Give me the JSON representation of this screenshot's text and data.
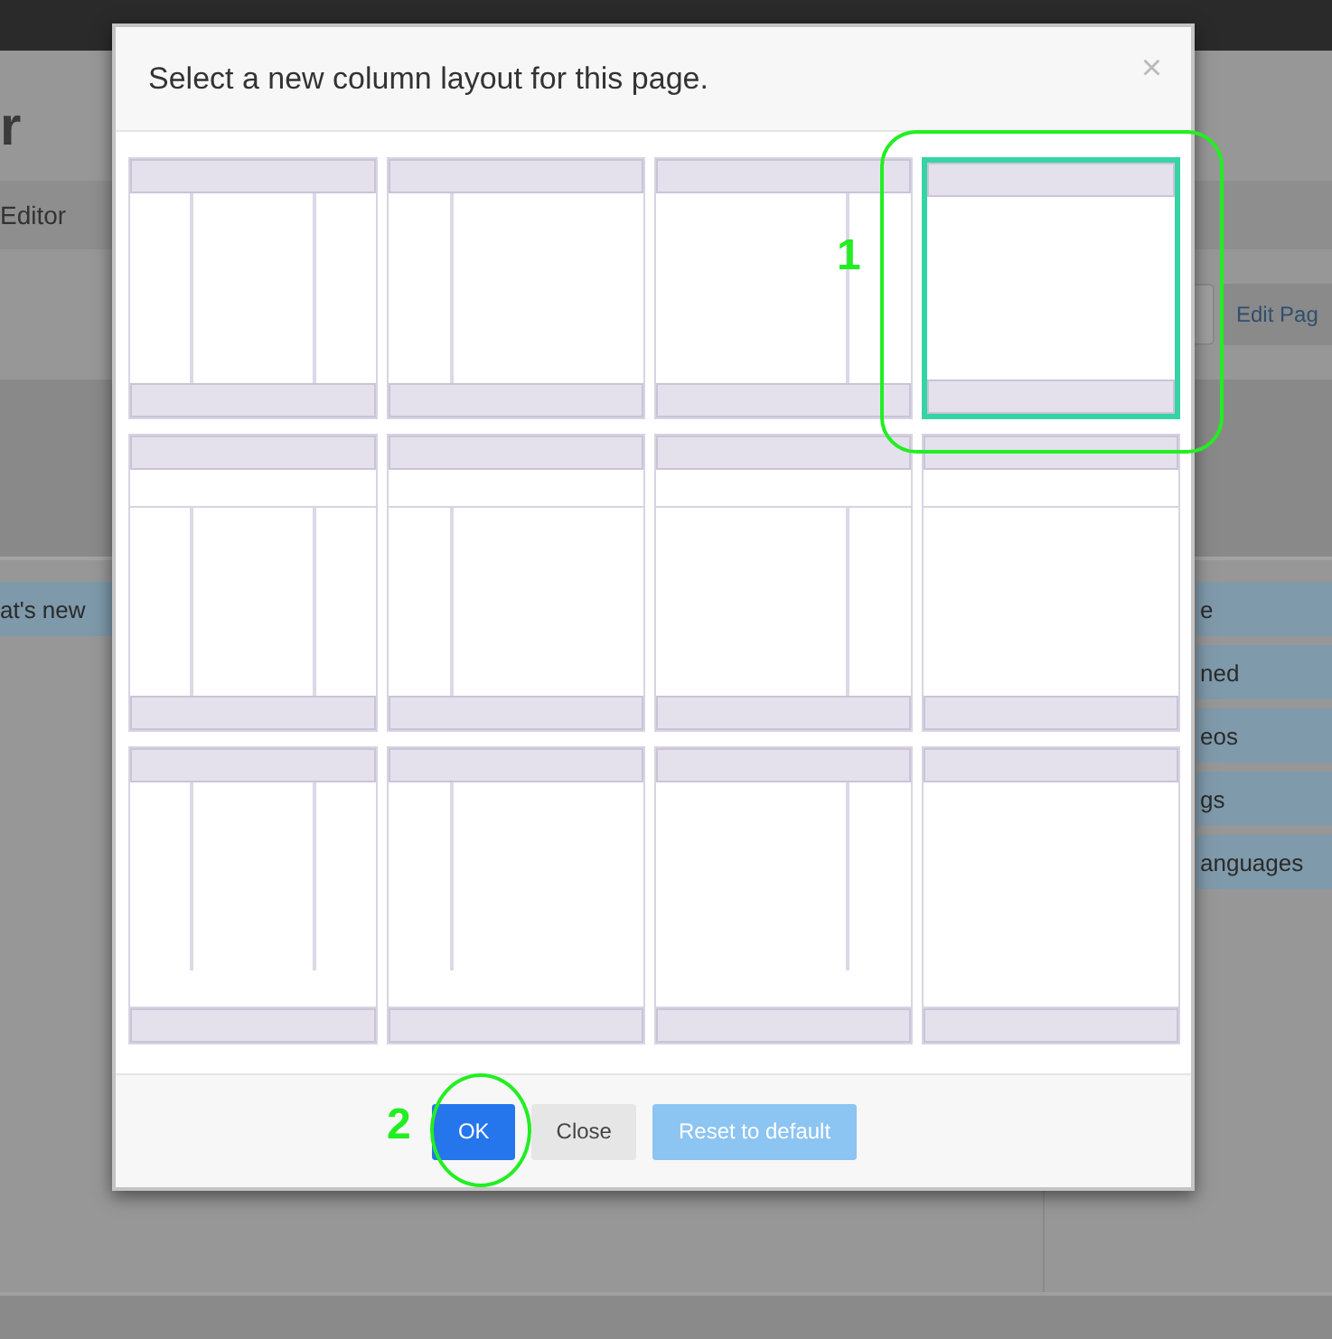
{
  "background_page": {
    "heading": "r",
    "tab": "Editor",
    "edit_link": "Edit Pag",
    "left_item": "at's new",
    "right_items": [
      "e",
      "ned",
      "eos",
      "gs",
      "anguages"
    ]
  },
  "dialog": {
    "title": "Select a new column layout for this page.",
    "close": "×",
    "layouts": [
      {
        "kind": "three",
        "top_band": false,
        "bottom_band": false,
        "selected": false
      },
      {
        "kind": "left",
        "top_band": false,
        "bottom_band": false,
        "selected": false
      },
      {
        "kind": "right",
        "top_band": false,
        "bottom_band": false,
        "selected": false
      },
      {
        "kind": "single",
        "top_band": false,
        "bottom_band": false,
        "selected": true
      },
      {
        "kind": "three",
        "top_band": true,
        "bottom_band": false,
        "selected": false
      },
      {
        "kind": "left",
        "top_band": true,
        "bottom_band": false,
        "selected": false
      },
      {
        "kind": "right",
        "top_band": true,
        "bottom_band": false,
        "selected": false
      },
      {
        "kind": "single",
        "top_band": true,
        "bottom_band": false,
        "selected": false
      },
      {
        "kind": "three",
        "top_band": false,
        "bottom_band": true,
        "selected": false
      },
      {
        "kind": "left",
        "top_band": false,
        "bottom_band": true,
        "selected": false
      },
      {
        "kind": "right",
        "top_band": false,
        "bottom_band": true,
        "selected": false
      },
      {
        "kind": "single",
        "top_band": false,
        "bottom_band": true,
        "selected": false
      }
    ],
    "buttons": [
      {
        "label": "OK",
        "kind": "primary"
      },
      {
        "label": "Close",
        "kind": "secondary"
      },
      {
        "label": "Reset to default",
        "kind": "disabled"
      }
    ]
  },
  "annotations": [
    {
      "label": "1"
    },
    {
      "label": "2"
    }
  ]
}
